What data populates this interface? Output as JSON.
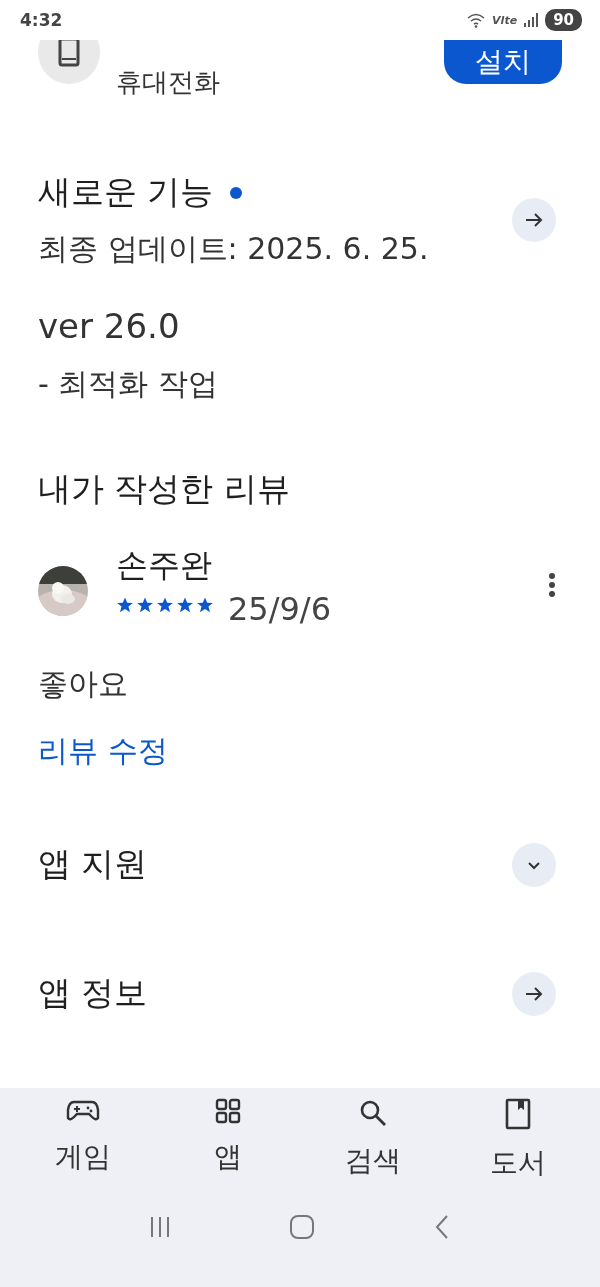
{
  "status_bar": {
    "time": "4:32",
    "network": "Vlte",
    "battery": "90"
  },
  "app_header": {
    "subtitle": "휴대전화",
    "install_button": "설치"
  },
  "whats_new": {
    "title": "새로운 기능",
    "updated": "최종 업데이트: 2025. 6. 25.",
    "version": "ver 26.0",
    "notes": "- 최적화 작업"
  },
  "my_review": {
    "title": "내가 작성한 리뷰",
    "author": "손주완",
    "stars": 5,
    "date": "25/9/6",
    "text": "좋아요",
    "edit_link": "리뷰 수정"
  },
  "sections": [
    {
      "title": "앱 지원",
      "kind": "expand"
    },
    {
      "title": "앱 정보",
      "kind": "arrow"
    }
  ],
  "bottom_nav": [
    {
      "label": "게임",
      "kind": "games"
    },
    {
      "label": "앱",
      "kind": "apps"
    },
    {
      "label": "검색",
      "kind": "search"
    },
    {
      "label": "도서",
      "kind": "books"
    }
  ]
}
